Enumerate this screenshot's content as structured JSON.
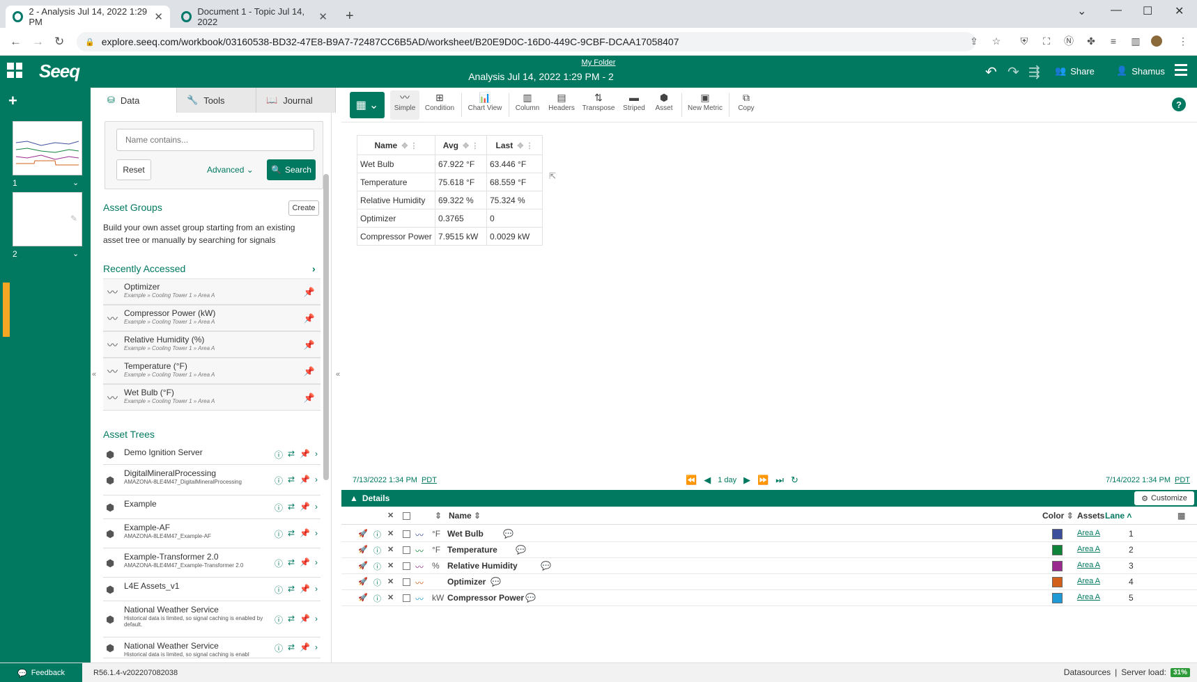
{
  "browser": {
    "tabs": [
      {
        "title": "2 - Analysis Jul 14, 2022 1:29 PM"
      },
      {
        "title": "Document 1 - Topic Jul 14, 2022"
      }
    ],
    "url": "explore.seeq.com/workbook/03160538-BD32-47E8-B9A7-72487CC6B5AD/worksheet/B20E9D0C-16D0-449C-9CBF-DCAA17058407"
  },
  "header": {
    "logo": "Seeq",
    "folder": "My Folder",
    "title": "Analysis Jul 14, 2022 1:29 PM - 2",
    "share_label": "Share",
    "user_label": "Shamus",
    "brand_color": "#007960"
  },
  "worksheets": [
    {
      "number": "1"
    },
    {
      "number": "2"
    }
  ],
  "panel": {
    "tabs": [
      {
        "label": "Data",
        "icon": "database-icon"
      },
      {
        "label": "Tools",
        "icon": "wrench-icon"
      },
      {
        "label": "Journal",
        "icon": "book-icon"
      }
    ],
    "search": {
      "placeholder": "Name contains...",
      "reset_label": "Reset",
      "advanced_label": "Advanced",
      "search_label": "Search"
    },
    "asset_groups": {
      "title": "Asset Groups",
      "create_label": "Create",
      "description": "Build your own asset group starting from an existing asset tree or manually by searching for signals"
    },
    "recently_accessed": {
      "title": "Recently Accessed",
      "items": [
        {
          "name": "Optimizer",
          "path": "Example » Cooling Tower 1 » Area A"
        },
        {
          "name": "Compressor Power (kW)",
          "path": "Example » Cooling Tower 1 » Area A"
        },
        {
          "name": "Relative Humidity (%)",
          "path": "Example » Cooling Tower 1 » Area A"
        },
        {
          "name": "Temperature (°F)",
          "path": "Example » Cooling Tower 1 » Area A"
        },
        {
          "name": "Wet Bulb (°F)",
          "path": "Example » Cooling Tower 1 » Area A"
        }
      ]
    },
    "asset_trees": {
      "title": "Asset Trees",
      "items": [
        {
          "name": "Demo Ignition Server",
          "sub": ""
        },
        {
          "name": "DigitalMineralProcessing",
          "sub": "AMAZONA-8LE4M47_DigitalMineralProcessing"
        },
        {
          "name": "Example",
          "sub": ""
        },
        {
          "name": "Example-AF",
          "sub": "AMAZONA-8LE4M47_Example-AF"
        },
        {
          "name": "Example-Transformer 2.0",
          "sub": "AMAZONA-8LE4M47_Example-Transformer 2.0"
        },
        {
          "name": "L4E Assets_v1",
          "sub": ""
        },
        {
          "name": "National Weather Service",
          "sub": "Historical data is limited, so signal caching is enabled by default."
        },
        {
          "name": "National Weather Service",
          "sub": "Historical data is limited, so signal caching is enabl"
        }
      ]
    }
  },
  "toolbar": {
    "tools": [
      "Simple",
      "Condition",
      "Chart View",
      "Column",
      "Headers",
      "Transpose",
      "Striped",
      "Asset",
      "New Metric",
      "Copy"
    ]
  },
  "table": {
    "columns": [
      "Name",
      "Avg",
      "Last"
    ],
    "rows": [
      [
        "Wet Bulb",
        "67.922 °F",
        "63.446 °F"
      ],
      [
        "Temperature",
        "75.618 °F",
        "68.559 °F"
      ],
      [
        "Relative Humidity",
        "69.322 %",
        "75.324 %"
      ],
      [
        "Optimizer",
        "0.3765",
        "0"
      ],
      [
        "Compressor Power",
        "7.9515 kW",
        "0.0029 kW"
      ]
    ]
  },
  "timebar": {
    "start": "7/13/2022 1:34 PM",
    "end": "7/14/2022 1:34 PM",
    "tz": "PDT",
    "duration": "1 day"
  },
  "details": {
    "title": "Details",
    "customize_label": "Customize",
    "headers": {
      "name": "Name",
      "color": "Color",
      "assets": "Assets",
      "lane": "Lane"
    },
    "rows": [
      {
        "unit": "°F",
        "name": "Wet Bulb",
        "color": "#3d4f9c",
        "asset": "Area A",
        "lane": "1"
      },
      {
        "unit": "°F",
        "name": "Temperature",
        "color": "#10833a",
        "asset": "Area A",
        "lane": "2"
      },
      {
        "unit": "%",
        "name": "Relative Humidity",
        "color": "#9b2a8e",
        "asset": "Area A",
        "lane": "3"
      },
      {
        "unit": "",
        "name": "Optimizer",
        "color": "#d2601a",
        "asset": "Area A",
        "lane": "4"
      },
      {
        "unit": "kW",
        "name": "Compressor Power",
        "color": "#1f9ad6",
        "asset": "Area A",
        "lane": "5"
      }
    ]
  },
  "footer": {
    "feedback_label": "Feedback",
    "version": "R56.1.4-v202207082038",
    "datasources_label": "Datasources",
    "server_load_label": "Server load:",
    "server_load_value": "31%"
  }
}
